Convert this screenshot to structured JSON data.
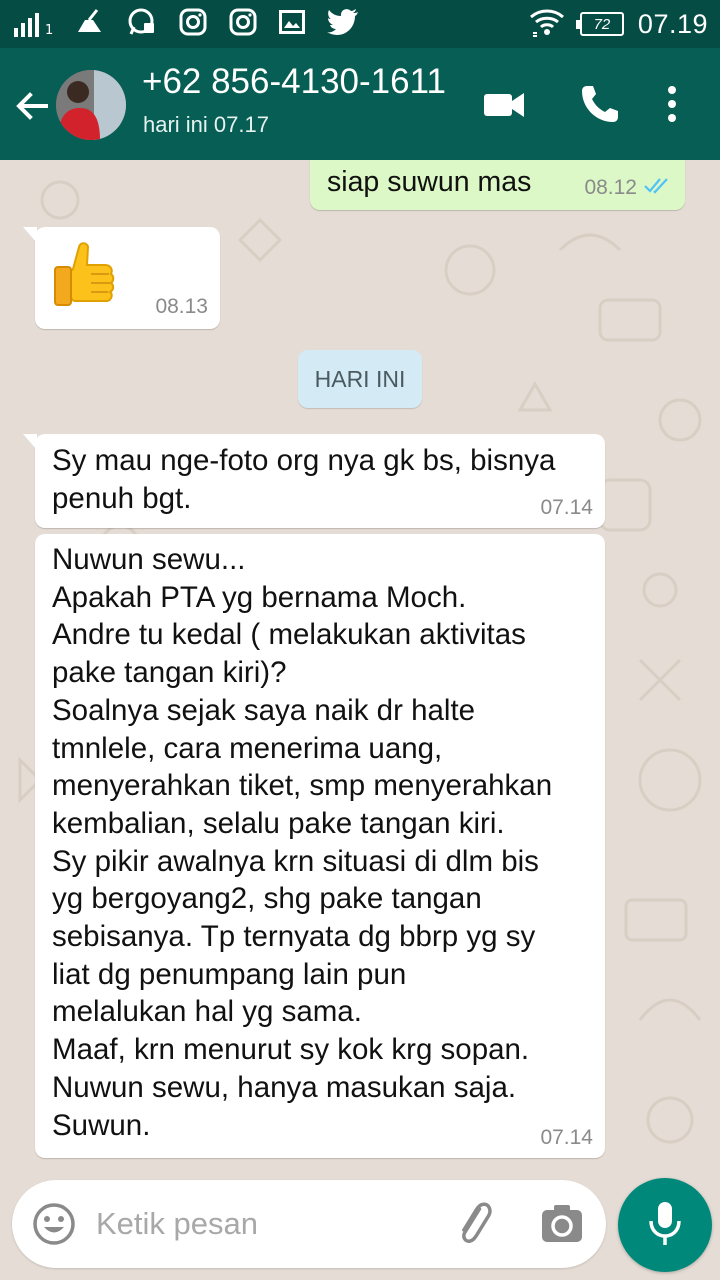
{
  "status_bar": {
    "signal_sub": "1",
    "battery": "72",
    "time": "07.19"
  },
  "header": {
    "contact_name": "+62 856-4130-1611",
    "last_seen": "hari ini 07.17"
  },
  "messages": [
    {
      "dir": "out",
      "text": "siap suwun mas",
      "time": "08.12",
      "status": "read"
    },
    {
      "dir": "in",
      "text": "👍",
      "time": "08.13"
    },
    {
      "dir": "in",
      "text": "Sy mau nge-foto org nya gk bs, bisnya\npenuh bgt.",
      "time": "07.14"
    },
    {
      "dir": "in",
      "text": "Nuwun sewu...\nApakah PTA yg bernama Moch.\nAndre tu kedal ( melakukan aktivitas\npake tangan kiri)?\nSoalnya sejak saya naik dr halte\ntmnlele, cara menerima uang,\nmenyerahkan tiket, smp menyerahkan\nkembalian, selalu pake tangan kiri.\nSy pikir awalnya krn situasi di dlm bis\nyg bergoyang2, shg pake tangan\nsebisanya. Tp ternyata dg bbrp yg sy\nliat dg penumpang lain pun\nmelalukan hal yg sama.\nMaaf, krn menurut sy kok krg sopan.\nNuwun sewu, hanya masukan saja.\nSuwun.",
      "time": "07.14"
    }
  ],
  "date_divider": "HARI INI",
  "composer": {
    "placeholder": "Ketik pesan"
  },
  "colors": {
    "primary": "#075e54",
    "status_bar": "#054d44",
    "outgoing_bubble": "#dcf8c6",
    "incoming_bubble": "#ffffff",
    "fab": "#00897b",
    "read_ticks": "#4fc3f7"
  },
  "icons": {
    "back": "arrow-left-icon",
    "video": "videocam-icon",
    "call": "phone-icon",
    "menu": "more-vert-icon",
    "emoji": "emoji-icon",
    "attach": "paperclip-icon",
    "camera": "camera-icon",
    "mic": "mic-icon"
  }
}
